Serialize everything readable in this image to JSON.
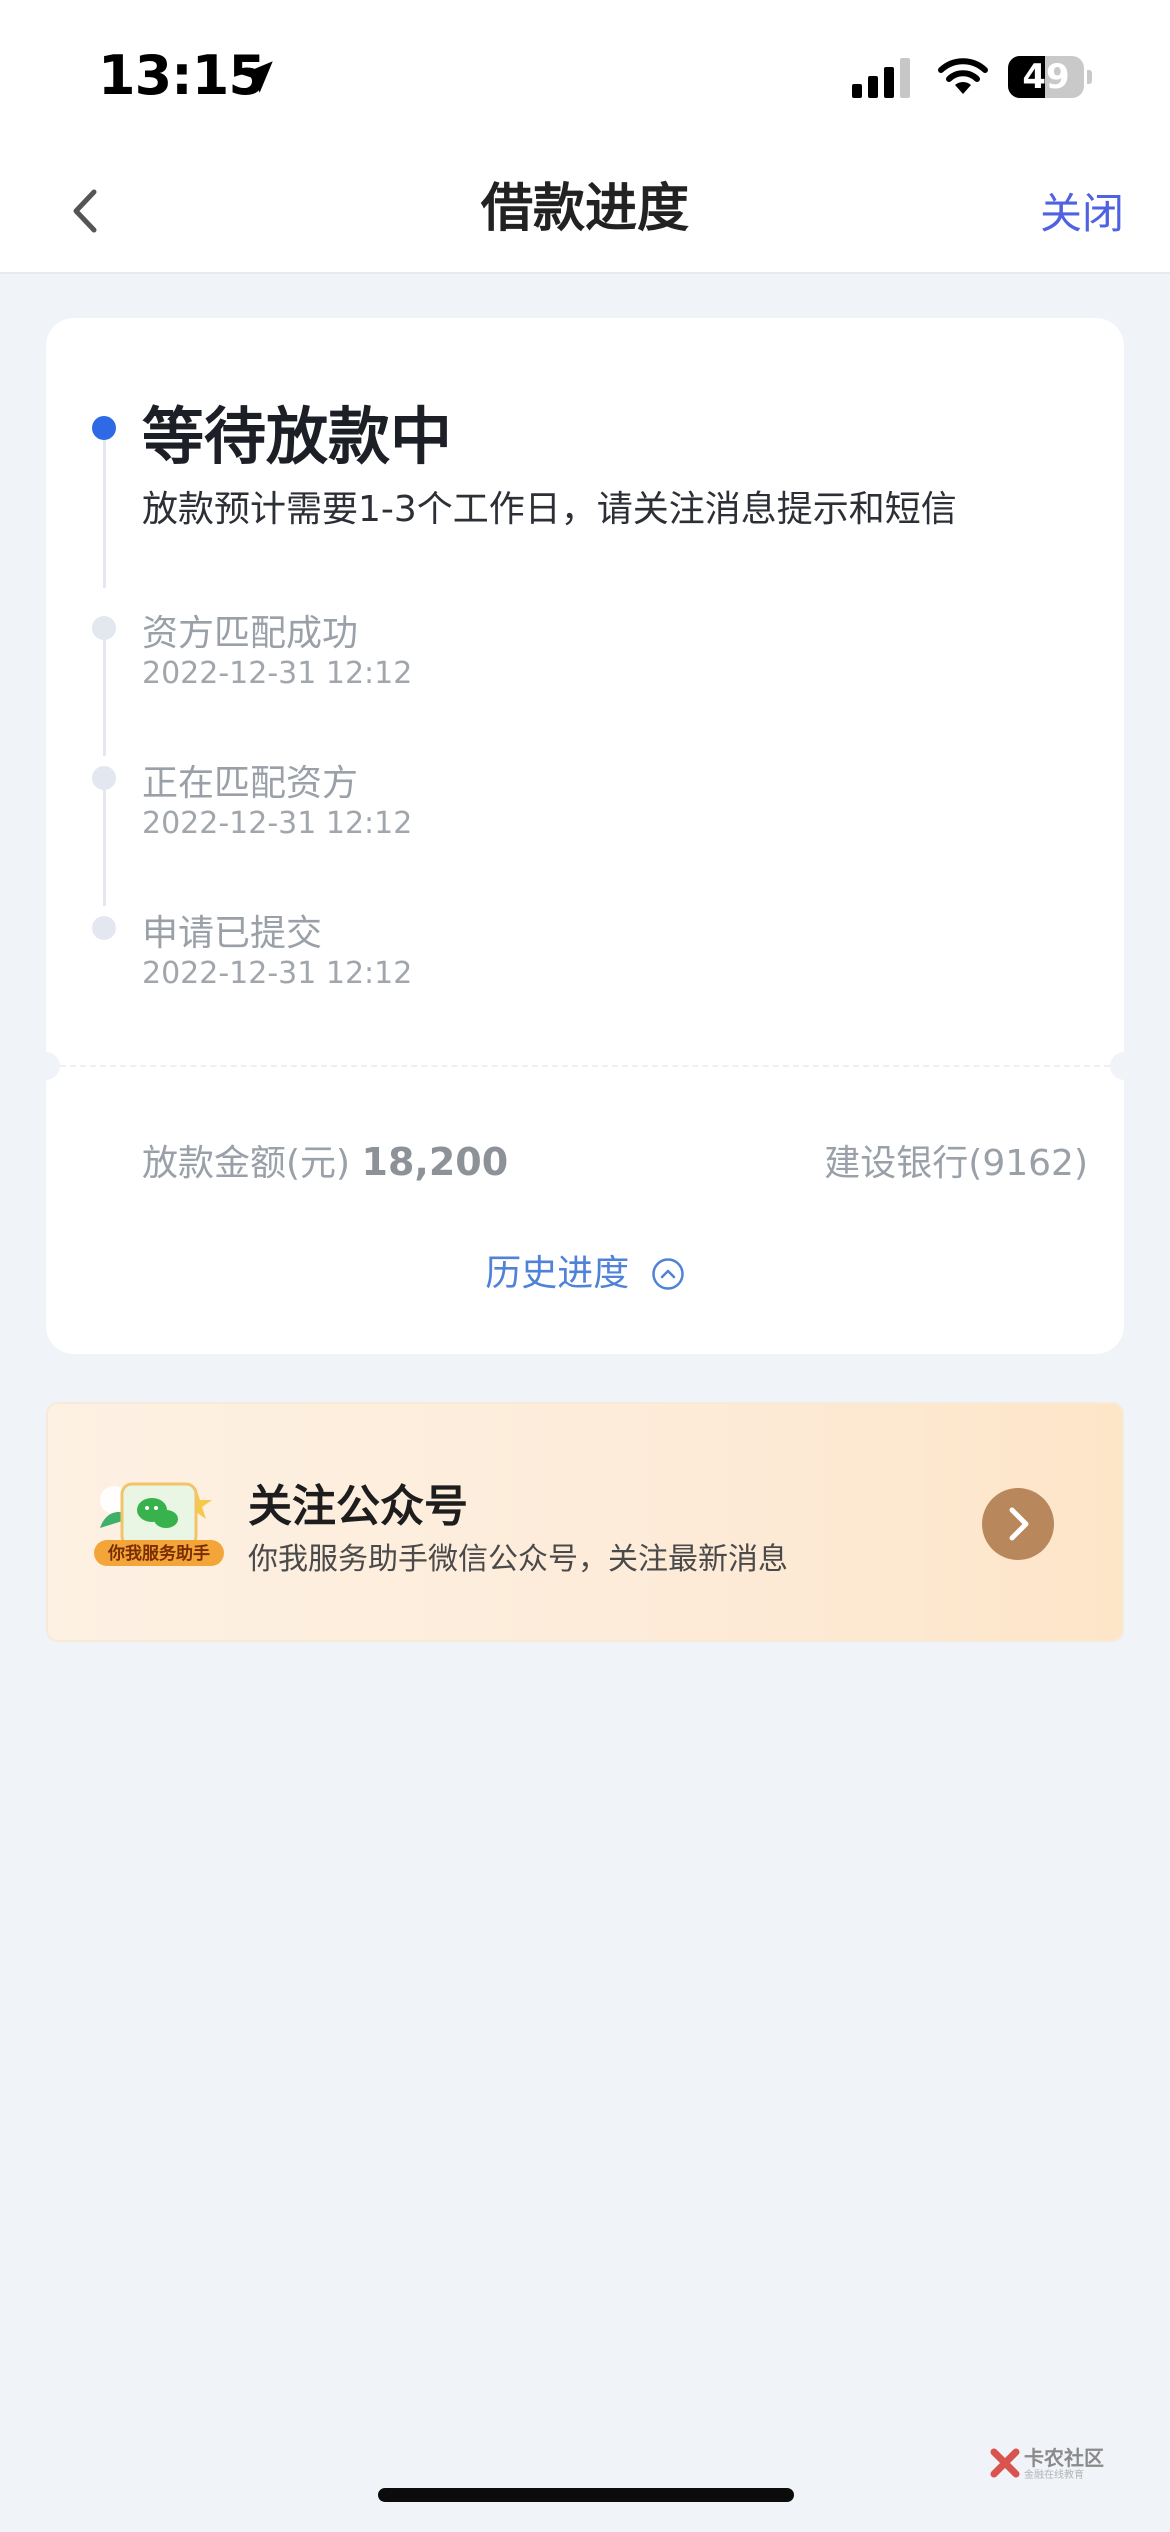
{
  "status_bar": {
    "time": "13:15",
    "battery_percent": 49,
    "battery_label": "49"
  },
  "nav": {
    "title": "借款进度",
    "close_label": "关闭"
  },
  "progress": {
    "current": {
      "title": "等待放款中",
      "desc": "放款预计需要1-3个工作日，请关注消息提示和短信"
    },
    "steps": [
      {
        "title": "资方匹配成功",
        "time": "2022-12-31 12:12"
      },
      {
        "title": "正在匹配资方",
        "time": "2022-12-31 12:12"
      },
      {
        "title": "申请已提交",
        "time": "2022-12-31 12:12"
      }
    ],
    "amount_label": "放款金额(元)",
    "amount_value": "18,200",
    "bank": "建设银行(9162)",
    "history_label": "历史进度"
  },
  "promo": {
    "badge_text": "你我服务助手",
    "title": "关注公众号",
    "subtitle": "你我服务助手微信公众号，关注最新消息"
  },
  "watermark": {
    "title": "卡农社区",
    "subtitle": "金融在线教育"
  },
  "colors": {
    "accent_blue": "#2f6ae6",
    "close_blue": "#4f62e0",
    "promo_arrow": "#b9875c"
  }
}
